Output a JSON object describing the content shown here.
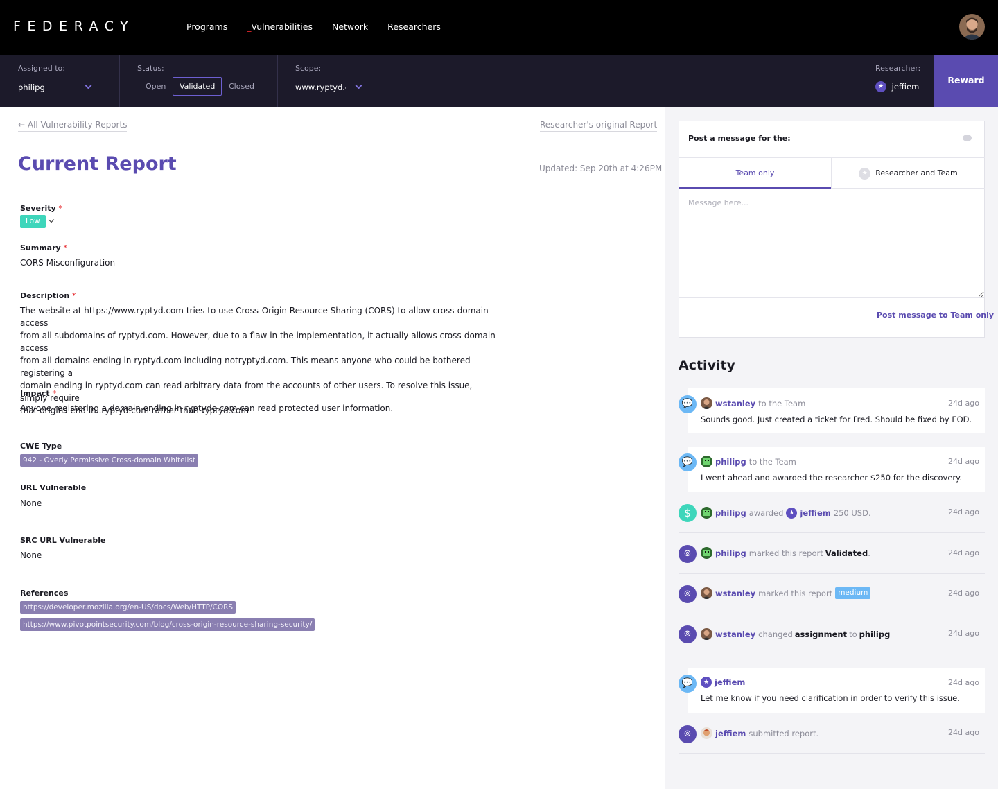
{
  "nav": {
    "logo": "FEDERACY",
    "links": [
      "Programs",
      "_",
      "Vulnerabilities",
      "Network",
      "Researchers"
    ]
  },
  "filters": {
    "assigned_label": "Assigned to:",
    "assigned_value": "philipg",
    "status_label": "Status:",
    "status_options": [
      "Open",
      "Validated",
      "Closed"
    ],
    "status_selected": "Validated",
    "scope_label": "Scope:",
    "scope_value": "www.ryptyd.cc",
    "researcher_label": "Researcher:",
    "researcher_value": "jeffiem",
    "reward_label": "Reward"
  },
  "report": {
    "back_link": "← All Vulnerability Reports",
    "original_link": "Researcher's original Report",
    "title": "Current Report",
    "updated": "Updated: Sep 20th at 4:26PM",
    "severity_label": "Severity",
    "severity_value": "Low",
    "summary_label": "Summary",
    "summary_value": "CORS Misconfiguration",
    "description_label": "Description",
    "description_lines": [
      "The website at https://www.ryptyd.com tries to use Cross-Origin Resource Sharing (CORS) to allow cross-domain access",
      "from all subdomains of ryptyd.com. However, due to a flaw in the implementation, it actually allows cross-domain access",
      "from all domains ending in ryptyd.com including notryptyd.com. This means anyone who could be bothered registering a",
      "domain ending in ryptyd.com can read arbitrary data from the accounts of other users. To resolve this issue, simply require",
      "that origins end in .ryptyd.com rather than ryptyd.com"
    ],
    "impact_label": "Impact",
    "impact_value": "Anyone registering a domain ending in ryptyde.com can read protected user information.",
    "cwe_label": "CWE Type",
    "cwe_value": "942 - Overly Permissive Cross-domain Whitelist",
    "url_label": "URL Vulnerable",
    "url_value": "None",
    "src_label": "SRC URL Vulnerable",
    "src_value": "None",
    "refs_label": "References",
    "refs": [
      "https://developer.mozilla.org/en-US/docs/Web/HTTP/CORS",
      "https://www.pivotpointsecurity.com/blog/cross-origin-resource-sharing-security/"
    ],
    "required_mark": "*"
  },
  "message": {
    "heading": "Post a message for the:",
    "tab_team": "Team only",
    "tab_rt": "Researcher and Team",
    "placeholder": "Message here...",
    "post_button": "Post message to Team only"
  },
  "activity": {
    "title": "Activity",
    "items": [
      {
        "user": "wstanley",
        "action": "to the Team",
        "time": "24d ago",
        "text": "Sounds good. Just created a ticket for Fred. Should be fixed by EOD."
      },
      {
        "user": "philipg",
        "action": "to the Team",
        "time": "24d ago",
        "text": "I went ahead and awarded the researcher $250 for the discovery."
      },
      {
        "user": "philipg",
        "action": "awarded",
        "target": "jeffiem",
        "amount": "250 USD.",
        "time": "24d ago"
      },
      {
        "user": "philipg",
        "action": "marked this report",
        "value": "Validated",
        "suffix": ".",
        "time": "24d ago"
      },
      {
        "user": "wstanley",
        "action": "marked this report",
        "badge": "medium",
        "time": "24d ago"
      },
      {
        "user": "wstanley",
        "action": "changed",
        "value": "assignment",
        "connector": "to",
        "target": "philipg",
        "time": "24d ago"
      },
      {
        "user": "jeffiem",
        "time": "24d ago",
        "text": "Let me know if you need clarification in order to verify this issue."
      },
      {
        "user": "jeffiem",
        "action": "submitted report.",
        "time": "24d ago"
      }
    ]
  },
  "colors": {
    "brand": "#5a4bb0",
    "nav_bg": "#000000",
    "filter_bg": "#1c1a2a",
    "severity_low": "#3ed6bb",
    "medium_badge": "#6cb8f5",
    "required": "#e5252a"
  },
  "icons": [
    "user-avatar",
    "chevron-down-icon",
    "star-icon",
    "chat-bubble-icon",
    "dollar-icon",
    "radar-icon"
  ]
}
